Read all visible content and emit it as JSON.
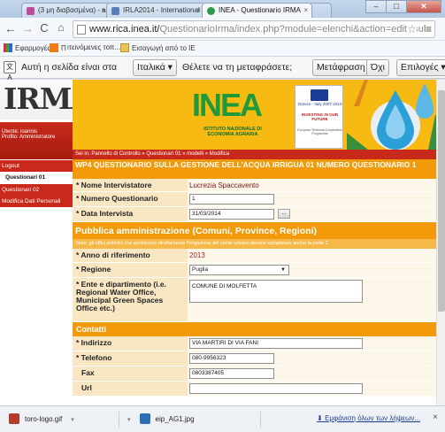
{
  "browser": {
    "tabs": [
      {
        "label": "(3 μη διαβασμένα) - agro",
        "close": "×"
      },
      {
        "label": "IRLA2014 - International S",
        "close": "×"
      },
      {
        "label": "INEA - Questionario IRMA",
        "close": "×"
      }
    ],
    "url_host": "www.rica.inea.it/",
    "url_path": "QuestionarioIrma/index.php?module=elenchi&action=edit&sub",
    "bookmarks": [
      {
        "label": "Εφαρμογές"
      },
      {
        "label": "Π"
      },
      {
        "label": "ιτεινόμενες τοπ..."
      },
      {
        "label": "Εισαγωγή από το IE"
      }
    ]
  },
  "translate_bar": {
    "prefix": "Αυτή η σελίδα είναι στα",
    "language": "Ιταλικά",
    "question": "Θέλετε να τη μεταφράσετε;",
    "translate_button": "Μετάφραση",
    "no_button": "Όχι",
    "options_button": "Επιλογές",
    "close": "×"
  },
  "app": {
    "logo": "IRMA",
    "user_line": "Utente: ioannis",
    "profile_line": "Profilo: Amministratore",
    "menu": [
      {
        "label": "Logout"
      },
      {
        "label": "Questionari 01"
      },
      {
        "label": "Questionari 02"
      },
      {
        "label": "Modifica Dati Personali"
      }
    ],
    "inea": {
      "big": "INEA",
      "sub": "ISTITUTO NAZIONALE DI ECONOMIA AGRARIA"
    },
    "eu_badge": {
      "line1": "Greece - Italy 2007-2013",
      "line2": "INVESTING IN OUR FUTURE",
      "line3": "European Territorial Cooperation Programme"
    },
    "breadcrumb": "Sei in: Pannello di Controllo » Questionari 01 » modelli » Modifica"
  },
  "form": {
    "title": "WP4 QUESTIONARIO SULLA GESTIONE DELL'ACQUA IRRIGUA 01 NUMERO QUESTIONARIO 1",
    "rows1": [
      {
        "label": "* Nome Intervistatore",
        "value": "Lucrezia Spaccavento"
      },
      {
        "label": "* Numero Questionario",
        "value": "1"
      },
      {
        "label": "* Data Intervista",
        "value": "31/03/2014",
        "button": "..."
      }
    ],
    "section1": "Pubblica amministrazione (Comuni, Province, Regioni)",
    "section1_note": "Note: gli uffici pubblici che gestiscono direttamente l'irrigazione del verde urbano devono completare anche la parte 2",
    "rows2": [
      {
        "label": "* Anno di riferimento",
        "value": "2013"
      },
      {
        "label": "* Regione",
        "value": "Puglia"
      },
      {
        "label": "* Ente e dipartimento (i.e. Regional Water Office, Municipal Green Spaces Office etc.)",
        "value": "COMUNE DI MOLFETTA"
      }
    ],
    "section2": "Contatti",
    "rows3": [
      {
        "label": "* Indirizzo",
        "value": "VIA MARTIRI DI VIA FANI"
      },
      {
        "label": "* Telefono",
        "value": "080-9956323"
      },
      {
        "label": "Fax",
        "value": "0803387405"
      },
      {
        "label": "Url",
        "value": ""
      }
    ]
  },
  "downloads": [
    {
      "label": "toro-logo.gif"
    },
    {
      "label": "eip_AG1.jpg"
    }
  ],
  "downloads_all": "Εμφάνιση όλων των λήψεων...",
  "downloads_close": "×",
  "colors": {
    "accent_orange": "#f39a0b",
    "header_yellow": "#f6ba13",
    "menu_red": "#c8291a",
    "inea_green": "#1f9a3a"
  }
}
